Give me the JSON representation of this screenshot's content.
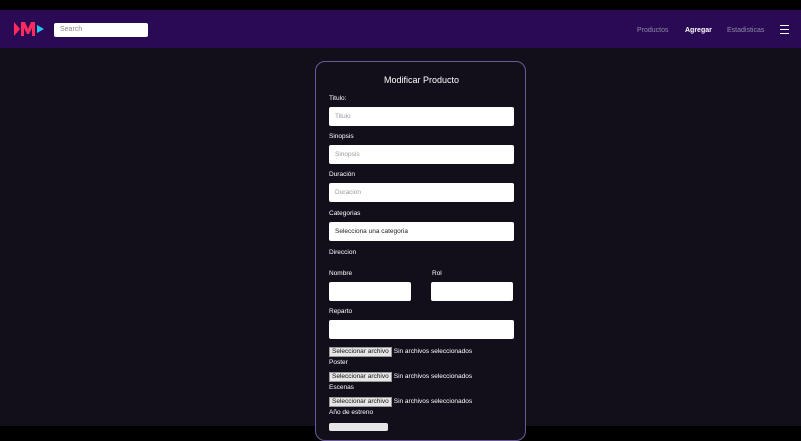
{
  "navbar": {
    "search_placeholder": "Search",
    "links": {
      "productos": "Productos",
      "agregar": "Agregar",
      "estadisticas": "Estadisticas"
    }
  },
  "colors": {
    "navbar_bg": "#2a0a55",
    "logo_red": "#ff2b5e",
    "logo_cyan": "#23c8f0",
    "card_border": "#6a5a9a"
  },
  "form": {
    "title": "Modificar Producto",
    "titulo": {
      "label": "Titulo:",
      "placeholder": "Titulo"
    },
    "sinopsis": {
      "label": "Sinopsis",
      "placeholder": "Sinopsis"
    },
    "duracion": {
      "label": "Duración",
      "placeholder": "Duracion"
    },
    "categorias": {
      "label": "Categorias",
      "selected": "Selecciona una categoria"
    },
    "direccion": {
      "label": "Direccion"
    },
    "nombre": {
      "label": "Nombre"
    },
    "rol": {
      "label": "Rol"
    },
    "reparto": {
      "label": "Reparto"
    },
    "file_button": "Seleccionar archivo",
    "file_status": "Sin archivos seleccionados",
    "poster": {
      "label": "Poster"
    },
    "escenas": {
      "label": "Escenas"
    },
    "anio": {
      "label": "Año de estreno"
    }
  }
}
